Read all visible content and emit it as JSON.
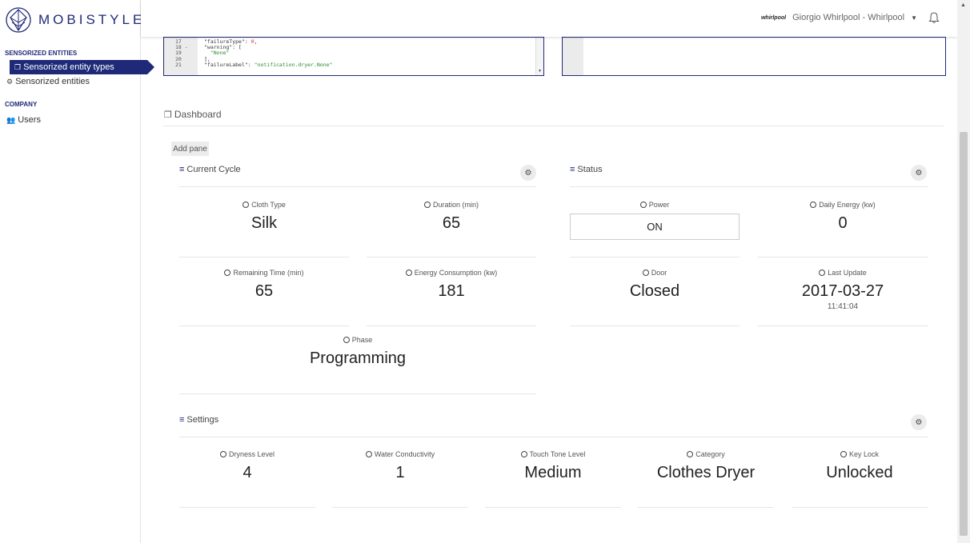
{
  "brand": {
    "name": "MOBISTYLE"
  },
  "sidebar": {
    "sections": [
      {
        "title": "SENSORIZED ENTITIES"
      },
      {
        "title": "COMPANY"
      }
    ],
    "items": [
      {
        "label": "Sensorized entity types",
        "active": true
      },
      {
        "label": "Sensorized entities"
      },
      {
        "label": "Users"
      }
    ]
  },
  "topbar": {
    "user_logo": "whirlpool",
    "user_name": "Giorgio Whirlpool - Whirlpool"
  },
  "editor": {
    "lines": [
      "17",
      "18 -",
      "19",
      "20",
      "21"
    ]
  },
  "dashboard": {
    "title": "Dashboard",
    "add_pane_label": "Add pane",
    "panes": {
      "current_cycle": {
        "title": "Current Cycle",
        "widgets": [
          {
            "label": "Cloth Type",
            "value": "Silk"
          },
          {
            "label": "Duration (min)",
            "value": "65"
          },
          {
            "label": "Remaining Time (min)",
            "value": "65"
          },
          {
            "label": "Energy Consumption (kw)",
            "value": "181"
          },
          {
            "label": "Phase",
            "value": "Programming"
          }
        ]
      },
      "status": {
        "title": "Status",
        "widgets": [
          {
            "label": "Power",
            "value": "ON"
          },
          {
            "label": "Daily Energy (kw)",
            "value": "0"
          },
          {
            "label": "Door",
            "value": "Closed"
          },
          {
            "label": "Last Update",
            "value": "2017-03-27",
            "sub": "11:41:04"
          }
        ]
      },
      "settings": {
        "title": "Settings",
        "widgets": [
          {
            "label": "Dryness Level",
            "value": "4"
          },
          {
            "label": "Water Conductivity",
            "value": "1"
          },
          {
            "label": "Touch Tone Level",
            "value": "Medium"
          },
          {
            "label": "Category",
            "value": "Clothes Dryer"
          },
          {
            "label": "Key Lock",
            "value": "Unlocked"
          }
        ]
      }
    }
  },
  "colors": {
    "brand": "#1e2a78",
    "divider": "#e6e6e6"
  }
}
